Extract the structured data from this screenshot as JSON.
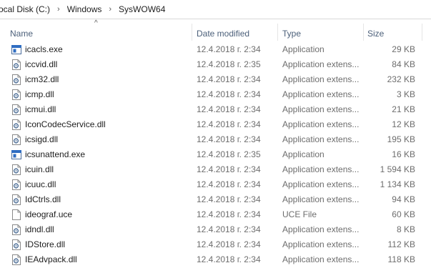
{
  "breadcrumb": [
    "ocal Disk (C:)",
    "Windows",
    "SysWOW64"
  ],
  "columns": {
    "name": "Name",
    "date": "Date modified",
    "type": "Type",
    "size": "Size"
  },
  "files": [
    {
      "name": "icacls.exe",
      "date": "12.4.2018 г. 2:34",
      "type": "Application",
      "size": "29 KB",
      "icon": "exe-icon"
    },
    {
      "name": "iccvid.dll",
      "date": "12.4.2018 г. 2:35",
      "type": "Application extens...",
      "size": "84 KB",
      "icon": "dll-icon"
    },
    {
      "name": "icm32.dll",
      "date": "12.4.2018 г. 2:34",
      "type": "Application extens...",
      "size": "232 KB",
      "icon": "dll-icon"
    },
    {
      "name": "icmp.dll",
      "date": "12.4.2018 г. 2:34",
      "type": "Application extens...",
      "size": "3 KB",
      "icon": "dll-icon"
    },
    {
      "name": "icmui.dll",
      "date": "12.4.2018 г. 2:34",
      "type": "Application extens...",
      "size": "21 KB",
      "icon": "dll-icon"
    },
    {
      "name": "IconCodecService.dll",
      "date": "12.4.2018 г. 2:34",
      "type": "Application extens...",
      "size": "12 KB",
      "icon": "dll-icon"
    },
    {
      "name": "icsigd.dll",
      "date": "12.4.2018 г. 2:34",
      "type": "Application extens...",
      "size": "195 KB",
      "icon": "dll-icon"
    },
    {
      "name": "icsunattend.exe",
      "date": "12.4.2018 г. 2:35",
      "type": "Application",
      "size": "16 KB",
      "icon": "exe-icon"
    },
    {
      "name": "icuin.dll",
      "date": "12.4.2018 г. 2:34",
      "type": "Application extens...",
      "size": "1 594 KB",
      "icon": "dll-icon"
    },
    {
      "name": "icuuc.dll",
      "date": "12.4.2018 г. 2:34",
      "type": "Application extens...",
      "size": "1 134 KB",
      "icon": "dll-icon"
    },
    {
      "name": "IdCtrls.dll",
      "date": "12.4.2018 г. 2:34",
      "type": "Application extens...",
      "size": "94 KB",
      "icon": "dll-icon"
    },
    {
      "name": "ideograf.uce",
      "date": "12.4.2018 г. 2:34",
      "type": "UCE File",
      "size": "60 KB",
      "icon": "file-icon"
    },
    {
      "name": "idndl.dll",
      "date": "12.4.2018 г. 2:34",
      "type": "Application extens...",
      "size": "8 KB",
      "icon": "dll-icon"
    },
    {
      "name": "IDStore.dll",
      "date": "12.4.2018 г. 2:34",
      "type": "Application extens...",
      "size": "112 KB",
      "icon": "dll-icon"
    },
    {
      "name": "IEAdvpack.dll",
      "date": "12.4.2018 г. 2:34",
      "type": "Application extens...",
      "size": "118 KB",
      "icon": "dll-icon"
    }
  ]
}
